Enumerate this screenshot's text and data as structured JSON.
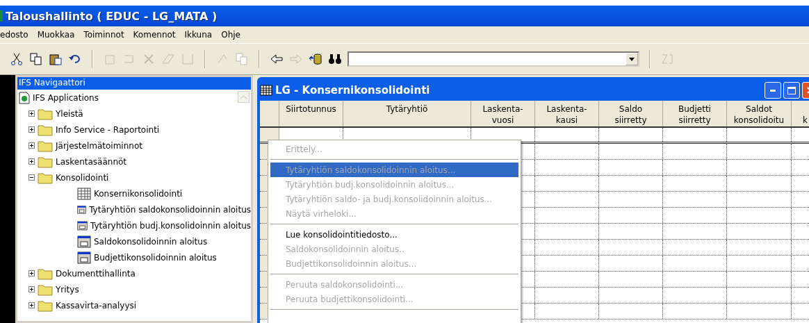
{
  "app_title": "Taloushallinto ( EDUC - LG_MATA )",
  "menu_bar": [
    "edosto",
    "Muokkaa",
    "Toiminnot",
    "Komennot",
    "Ikkuna",
    "Ohje"
  ],
  "toolbar": [
    {
      "kind": "cut",
      "disabled": false
    },
    {
      "kind": "copy",
      "disabled": false
    },
    {
      "kind": "paste",
      "disabled": false
    },
    {
      "kind": "undo",
      "disabled": false
    },
    {
      "kind": "separator"
    },
    {
      "kind": "new",
      "disabled": true
    },
    {
      "kind": "duplicate",
      "disabled": true
    },
    {
      "kind": "delete",
      "disabled": true
    },
    {
      "kind": "edit",
      "disabled": true
    },
    {
      "kind": "blank",
      "disabled": true
    },
    {
      "kind": "separator"
    },
    {
      "kind": "refresh",
      "disabled": true
    },
    {
      "kind": "copy",
      "disabled": true
    },
    {
      "kind": "separator"
    },
    {
      "kind": "back",
      "disabled": false
    },
    {
      "kind": "forward",
      "disabled": true
    },
    {
      "kind": "database",
      "disabled": false
    },
    {
      "kind": "find",
      "disabled": false
    },
    {
      "kind": "combo"
    },
    {
      "kind": "separator"
    },
    {
      "kind": "sort",
      "disabled": true
    }
  ],
  "navigator": {
    "title": "IFS Navigaattori",
    "root": "IFS Applications",
    "items": [
      {
        "label": "Yleistä",
        "expanded": false
      },
      {
        "label": "Info Service - Raportointi",
        "expanded": false
      },
      {
        "label": "Järjestelmätoiminnot",
        "expanded": false
      },
      {
        "label": "Laskentasäännöt",
        "expanded": false
      },
      {
        "label": "Konsolidointi",
        "expanded": true,
        "children": [
          {
            "label": "Konsernikonsolidointi",
            "kind": "form"
          },
          {
            "label": "Tytäryhtiön saldokonsolidoinnin aloitus",
            "kind": "dialog"
          },
          {
            "label": "Tytäryhtiön budj.konsolidoinnin aloitus",
            "kind": "dialog"
          },
          {
            "label": "Saldokonsolidoinnin aloitus",
            "kind": "dialog"
          },
          {
            "label": "Budjettikonsolidoinnin aloitus",
            "kind": "dialog"
          }
        ]
      },
      {
        "label": "Dokumenttihallinta",
        "expanded": false
      },
      {
        "label": "Yritys",
        "expanded": false
      },
      {
        "label": "Kassavirta-analyysi",
        "expanded": false
      }
    ]
  },
  "window": {
    "title": "LG - Konsernikonsolidointi",
    "columns": [
      "Siirtotunnus",
      "Tytäryhtiö",
      "Laskenta-\nvuosi",
      "Laskenta-\nkausi",
      "Saldo\nsiirretty",
      "Budjetti\nsiirretty",
      "Saldot\nkonsolidoitu",
      "\nk"
    ]
  },
  "context_menu": [
    {
      "kind": "item",
      "label": "Erittely...",
      "disabled": true,
      "selected": false
    },
    {
      "kind": "separator"
    },
    {
      "kind": "item",
      "label": "Tytäryhtiön saldokonsolidoinnin aloitus...",
      "disabled": true,
      "selected": true
    },
    {
      "kind": "item",
      "label": "Tytäryhtiön budj.konsolidoinnin aloitus...",
      "disabled": true,
      "selected": false
    },
    {
      "kind": "item",
      "label": "Tytäryhtiön saldo- ja budj.konsolidoinnin aloitus...",
      "disabled": true,
      "selected": false
    },
    {
      "kind": "item",
      "label": "Näytä virheloki...",
      "disabled": true,
      "selected": false
    },
    {
      "kind": "separator"
    },
    {
      "kind": "item",
      "label": "Lue konsolidointitiedosto...",
      "disabled": false,
      "selected": false
    },
    {
      "kind": "item",
      "label": "Saldokonsolidoinnin aloitus..",
      "disabled": true,
      "selected": false
    },
    {
      "kind": "item",
      "label": "Budjettikonsolidoinnin aloitus...",
      "disabled": true,
      "selected": false
    },
    {
      "kind": "separator"
    },
    {
      "kind": "item",
      "label": "Peruuta saldokonsolidointi...",
      "disabled": true,
      "selected": false
    },
    {
      "kind": "item",
      "label": "Peruuta budjettikonsolidointi...",
      "disabled": true,
      "selected": false
    },
    {
      "kind": "separator"
    }
  ]
}
